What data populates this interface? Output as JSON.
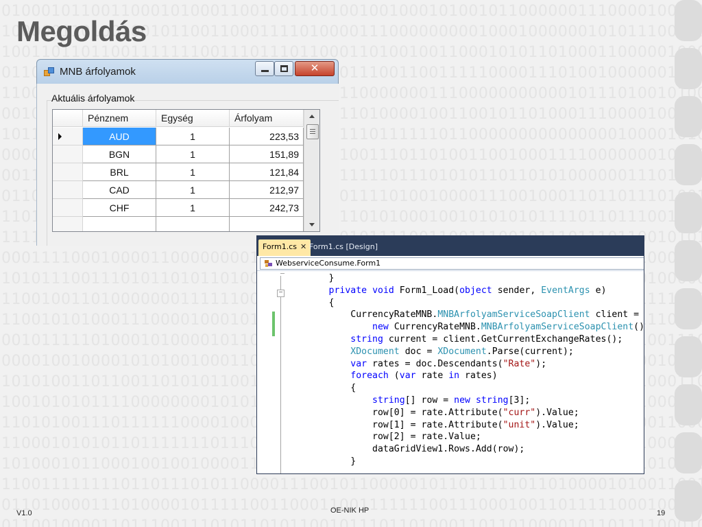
{
  "slide": {
    "title": "Megoldás",
    "footer_left": "V1.0",
    "footer_center": "OE-NIK HP",
    "page_number": "19"
  },
  "form_window": {
    "title": "MNB árfolyamok",
    "group_label": "Aktuális árfolyamok",
    "columns": [
      "Pénznem",
      "Egység",
      "Árfolyam"
    ],
    "rows": [
      {
        "currency": "AUD",
        "unit": "1",
        "rate": "223,53",
        "selected": true
      },
      {
        "currency": "BGN",
        "unit": "1",
        "rate": "151,89"
      },
      {
        "currency": "BRL",
        "unit": "1",
        "rate": "121,84"
      },
      {
        "currency": "CAD",
        "unit": "1",
        "rate": "212,97"
      },
      {
        "currency": "CHF",
        "unit": "1",
        "rate": "242,73"
      }
    ],
    "colors": {
      "selection": "#3399ff",
      "titlebar": "#c4d8ee",
      "close_button": "#c6432c"
    }
  },
  "code_editor": {
    "tabs": [
      {
        "label": "Form1.cs",
        "active": true
      },
      {
        "label": "Form1.cs [Design]",
        "active": false
      }
    ],
    "nav_class": "WebserviceConsume.Form1",
    "code_lines": [
      "        }",
      "        private void Form1_Load(object sender, EventArgs e)",
      "        {",
      "            CurrencyRateMNB.MNBArfolyamServiceSoapClient client =",
      "                new CurrencyRateMNB.MNBArfolyamServiceSoapClient();",
      "            string current = client.GetCurrentExchangeRates();",
      "            XDocument doc = XDocument.Parse(current);",
      "            var rates = doc.Descendants(\"Rate\");",
      "            foreach (var rate in rates)",
      "            {",
      "                string[] row = new string[3];",
      "                row[0] = rate.Attribute(\"curr\").Value;",
      "                row[1] = rate.Attribute(\"unit\").Value;",
      "                row[2] = rate.Value;",
      "                dataGridView1.Rows.Add(row);",
      "            }"
    ],
    "colors": {
      "keyword": "#0000ff",
      "type": "#2b91af",
      "string": "#a31515",
      "tab_bar": "#2b3c59",
      "active_tab": "#ffe8a6"
    }
  }
}
